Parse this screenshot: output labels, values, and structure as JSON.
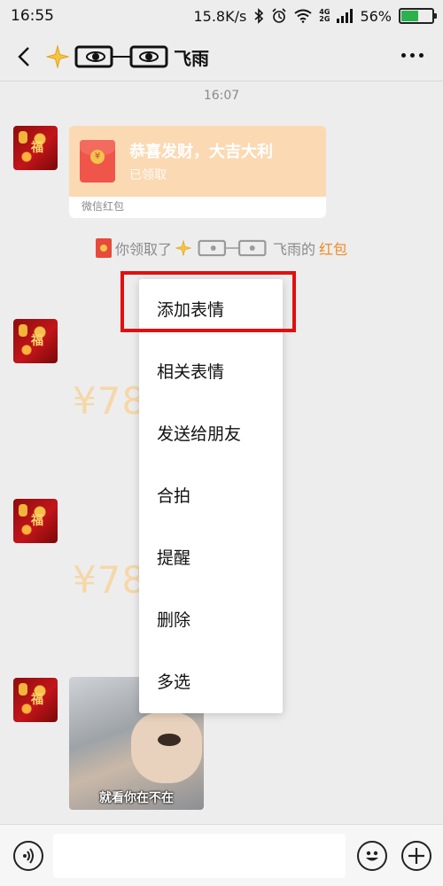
{
  "status_bar": {
    "time": "16:55",
    "speed": "15.8K/s",
    "net_top": "4G",
    "net_bottom": "2G",
    "battery_text": "56%",
    "battery_level": 0.56,
    "battery_color": "#2bb24c"
  },
  "nav": {
    "title": "飞雨",
    "icons": [
      "back-arrow",
      "sparkle",
      "glasses-eyes",
      "more-dots"
    ]
  },
  "chat": {
    "timestamp": "16:07",
    "red_packet": {
      "title": "恭喜发财，大吉大利",
      "status": "已领取",
      "footer": "微信红包"
    },
    "system_message": {
      "prefix": "你领取了",
      "name": "飞雨的",
      "link": "红包"
    },
    "amounts": [
      "¥78",
      "¥78"
    ],
    "gif_caption": "就看你在不在"
  },
  "context_menu": {
    "items": [
      "添加表情",
      "相关表情",
      "发送给朋友",
      "合拍",
      "提醒",
      "删除",
      "多选"
    ],
    "highlighted_index": 0,
    "highlight_color": "#e01010"
  },
  "input_bar": {
    "placeholder": ""
  },
  "colors": {
    "background": "#ededed",
    "red_packet": "#fbd9b3",
    "link_orange": "#f08a24"
  }
}
